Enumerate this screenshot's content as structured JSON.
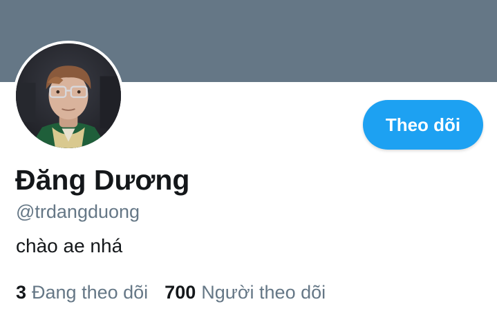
{
  "colors": {
    "banner": "#657786",
    "accent": "#1da1f2",
    "text_primary": "#14171a",
    "text_secondary": "#657786"
  },
  "profile": {
    "avatar_icon": "profile-photo",
    "display_name": "Đăng Dương",
    "handle": "@trdangduong",
    "bio": "chào ae nhá",
    "follow_button_label": "Theo dõi"
  },
  "stats": [
    {
      "count": "3",
      "label": "Đang theo dõi"
    },
    {
      "count": "700",
      "label": "Người theo dõi"
    }
  ]
}
